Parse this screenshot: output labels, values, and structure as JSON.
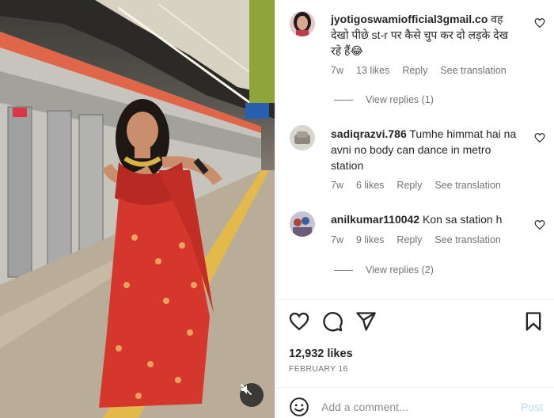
{
  "post": {
    "likes": "12,932 likes",
    "date": "FEBRUARY 16"
  },
  "comments": [
    {
      "username": "jyotigoswamiofficial3gmail.co",
      "text": "वह देखो पीछे st-r पर कैसे चुप कर दो लड़के देख रहे हैं😂",
      "age": "7w",
      "likes": "13 likes",
      "reply": "Reply",
      "translate": "See translation",
      "view_replies": "View replies (1)"
    },
    {
      "username": "sadiqrazvi.786",
      "text": "Tumhe himmat hai na avni no body can dance in metro station",
      "age": "7w",
      "likes": "6 likes",
      "reply": "Reply",
      "translate": "See translation"
    },
    {
      "username": "anilkumar110042",
      "text": "Kon sa station h",
      "age": "7w",
      "likes": "9 likes",
      "reply": "Reply",
      "translate": "See translation",
      "view_replies": "View replies (2)"
    }
  ],
  "composer": {
    "placeholder": "Add a comment...",
    "post_label": "Post"
  },
  "icons": {
    "like": "heart-icon",
    "comment": "comment-icon",
    "share": "send-icon",
    "save": "bookmark-icon",
    "emoji": "smiley-icon",
    "mute": "speaker-muted-icon"
  },
  "colors": {
    "meta_text": "#737373",
    "post_button": "#b2dffc",
    "saree_red": "#d6372c"
  }
}
